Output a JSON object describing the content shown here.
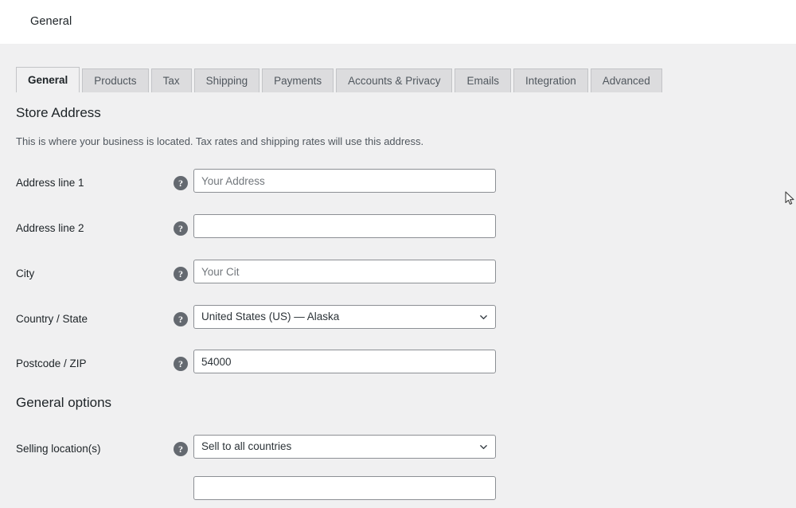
{
  "header": {
    "title": "General"
  },
  "tabs": [
    {
      "label": "General",
      "active": true
    },
    {
      "label": "Products",
      "active": false
    },
    {
      "label": "Tax",
      "active": false
    },
    {
      "label": "Shipping",
      "active": false
    },
    {
      "label": "Payments",
      "active": false
    },
    {
      "label": "Accounts & Privacy",
      "active": false
    },
    {
      "label": "Emails",
      "active": false
    },
    {
      "label": "Integration",
      "active": false
    },
    {
      "label": "Advanced",
      "active": false
    }
  ],
  "store_address": {
    "heading": "Store Address",
    "description": "This is where your business is located. Tax rates and shipping rates will use this address.",
    "fields": {
      "address_1": {
        "label": "Address line 1",
        "value": "",
        "placeholder": "Your Address",
        "help": "?"
      },
      "address_2": {
        "label": "Address line 2",
        "value": "",
        "placeholder": "",
        "help": "?"
      },
      "city": {
        "label": "City",
        "value": "",
        "placeholder": "Your Cit",
        "help": "?"
      },
      "country_state": {
        "label": "Country / State",
        "value": "United States (US) — Alaska",
        "help": "?"
      },
      "postcode": {
        "label": "Postcode / ZIP",
        "value": "54000",
        "placeholder": "",
        "help": "?"
      }
    }
  },
  "general_options": {
    "heading": "General options",
    "fields": {
      "selling_locations": {
        "label": "Selling location(s)",
        "value": "Sell to all countries",
        "help": "?"
      }
    }
  },
  "colors": {
    "page_background": "#f0f0f1",
    "header_background": "#ffffff",
    "tab_inactive_background": "#dcdcde",
    "tab_border": "#c3c4c7",
    "input_border": "#8c8f94",
    "text_primary": "#1d2327",
    "text_secondary": "#50575e",
    "placeholder": "#72777c",
    "help_icon": "#646970"
  }
}
